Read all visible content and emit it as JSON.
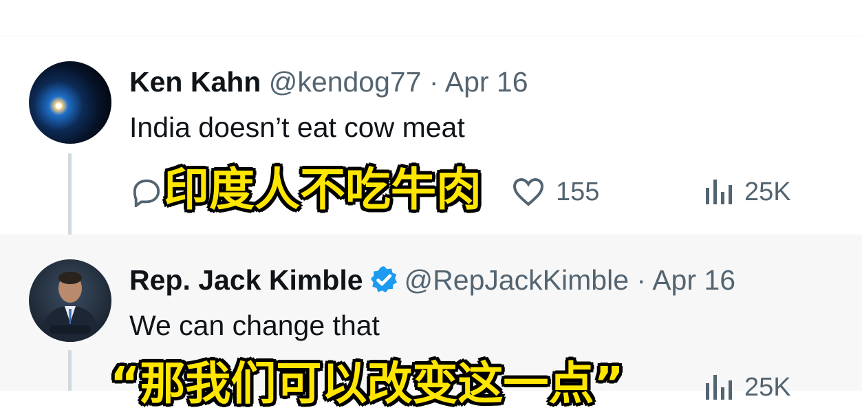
{
  "tweets": [
    {
      "name": "Ken Kahn",
      "handle": "@kendog77",
      "separator": "·",
      "date": "Apr 16",
      "text": "India doesn’t eat cow meat",
      "likes": "155",
      "views": "25K",
      "caption": "印度人不吃牛肉"
    },
    {
      "name": "Rep. Jack Kimble",
      "verified": true,
      "handle": "@RepJackKimble",
      "separator": "·",
      "date": "Apr 16",
      "text": "We can change that",
      "views": "25K",
      "caption": "“那我们可以改变这一点”"
    }
  ],
  "colors": {
    "secondary": "#536471",
    "verified": "#1d9bf0",
    "caption": "#ffe600",
    "thread_line": "#cfd9de"
  }
}
